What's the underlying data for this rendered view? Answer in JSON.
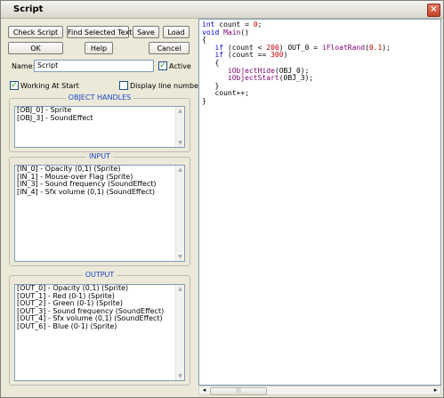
{
  "window": {
    "title": "Script",
    "close_glyph": "×"
  },
  "toolbar": {
    "check_script": "Check Script",
    "find_selected_text": "Find Selected Text",
    "save": "Save",
    "load": "Load",
    "ok": "OK",
    "help": "Help",
    "cancel": "Cancel"
  },
  "name_field": {
    "label": "Name:",
    "value": "Script"
  },
  "options": {
    "active_label": "Active",
    "active_checked": true,
    "working_at_start_label": "Working At Start",
    "working_at_start_checked": true,
    "display_line_numbers_label": "Display line numbers",
    "display_line_numbers_checked": false
  },
  "object_handles": {
    "title": "OBJECT HANDLES",
    "items": [
      "[OBJ_0] - Sprite",
      "[OBJ_3] - SoundEffect"
    ]
  },
  "input": {
    "title": "INPUT",
    "items": [
      "[IN_0] - Opacity (0,1) (Sprite)",
      "[IN_1] - Mouse-over Flag (Sprite)",
      "[IN_3] - Sound frequency (SoundEffect)",
      "[IN_4] - Sfx volume (0,1) (SoundEffect)"
    ]
  },
  "output": {
    "title": "OUTPUT",
    "items": [
      "[OUT_0] - Opacity (0,1) (Sprite)",
      "[OUT_1] - Red (0-1) (Sprite)",
      "[OUT_2] - Green (0-1) (Sprite)",
      "[OUT_3] - Sound frequency (SoundEffect)",
      "[OUT_4] - Sfx volume (0,1) (SoundEffect)",
      "[OUT_6] - Blue (0-1) (Sprite)"
    ]
  },
  "code_lines": [
    "int count = 0;",
    "void Main()",
    "{",
    "   if (count < 200) OUT_0 = iFloatRand(0.1);",
    "   if (count == 300)",
    "   {",
    "      iObjectHide(OBJ_0);",
    "      iObjectStart(OBJ_3);",
    "   }",
    "   count++;",
    "}"
  ],
  "colors": {
    "keyword": "#0000c0",
    "number": "#c00000",
    "function": "#7a0070",
    "group_title": "#1c46c8"
  },
  "icons": {
    "close": "close-icon",
    "check": "check-icon",
    "scroll_up": "arrow-up-icon",
    "scroll_down": "arrow-down-icon",
    "scroll_left": "arrow-left-icon",
    "scroll_right": "arrow-right-icon"
  }
}
